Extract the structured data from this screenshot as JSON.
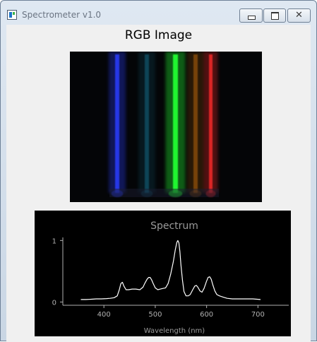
{
  "window": {
    "title": "Spectrometer v1.0",
    "controls": {
      "minimize": "minimize",
      "maximize": "maximize",
      "close": "close"
    },
    "close_glyph": "✕"
  },
  "image_panel": {
    "title": "RGB Image",
    "bands": [
      {
        "color": "#2a3cff",
        "brightness": 0.9
      },
      {
        "color": "#1fa0c8",
        "brightness": 0.35
      },
      {
        "color": "#22ff30",
        "brightness": 1.0
      },
      {
        "color": "#e07a10",
        "brightness": 0.45
      },
      {
        "color": "#ff2a2a",
        "brightness": 0.85
      }
    ]
  },
  "chart_data": {
    "type": "line",
    "title": "Spectrum",
    "xlabel": "Wavelength (nm)",
    "ylabel": "",
    "xlim": [
      320,
      760
    ],
    "ylim": [
      -0.03,
      1.05
    ],
    "xticks": [
      400,
      500,
      600,
      700
    ],
    "yticks": [
      0,
      1
    ],
    "grid": false,
    "series": [
      {
        "color": "#ffffff",
        "x": [
          355,
          365,
          375,
          385,
          395,
          405,
          412,
          420,
          426,
          430,
          433,
          436,
          439,
          443,
          448,
          455,
          462,
          470,
          476,
          480,
          484,
          487,
          490,
          493,
          496,
          500,
          505,
          510,
          515,
          520,
          525,
          530,
          535,
          539,
          542,
          544,
          546,
          548,
          550,
          553,
          556,
          560,
          564,
          568,
          573,
          577,
          580,
          583,
          587,
          591,
          595,
          600,
          603,
          606,
          609,
          612,
          616,
          620,
          625,
          632,
          640,
          650,
          662,
          675,
          690,
          705
        ],
        "y": [
          0.04,
          0.04,
          0.045,
          0.05,
          0.05,
          0.055,
          0.06,
          0.07,
          0.1,
          0.2,
          0.3,
          0.32,
          0.26,
          0.2,
          0.2,
          0.21,
          0.21,
          0.2,
          0.24,
          0.31,
          0.37,
          0.4,
          0.4,
          0.36,
          0.3,
          0.23,
          0.2,
          0.21,
          0.22,
          0.23,
          0.3,
          0.45,
          0.65,
          0.85,
          0.97,
          1.0,
          0.96,
          0.82,
          0.6,
          0.35,
          0.17,
          0.1,
          0.1,
          0.12,
          0.2,
          0.26,
          0.27,
          0.24,
          0.18,
          0.16,
          0.22,
          0.34,
          0.4,
          0.41,
          0.37,
          0.28,
          0.18,
          0.12,
          0.1,
          0.08,
          0.06,
          0.05,
          0.05,
          0.05,
          0.05,
          0.04
        ]
      }
    ]
  }
}
